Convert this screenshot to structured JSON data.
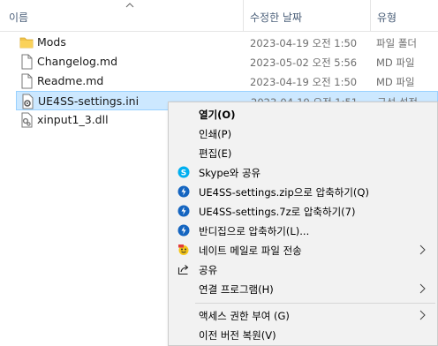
{
  "columns": {
    "name": "이름",
    "date": "수정한 날짜",
    "type": "유형"
  },
  "files": [
    {
      "name": "Mods",
      "date": "2023-04-19 오전 1:50",
      "type": "파일 폴더",
      "icon": "folder-icon"
    },
    {
      "name": "Changelog.md",
      "date": "2023-05-02 오전 5:56",
      "type": "MD 파일",
      "icon": "document-icon"
    },
    {
      "name": "Readme.md",
      "date": "2023-04-19 오전 1:50",
      "type": "MD 파일",
      "icon": "document-icon"
    },
    {
      "name": "UE4SS-settings.ini",
      "date": "2023-04-19 오전 1:51",
      "type": "구성 설정",
      "icon": "settings-file-icon"
    },
    {
      "name": "xinput1_3.dll",
      "date": "",
      "type": "",
      "icon": "dll-file-icon"
    }
  ],
  "menu": {
    "open": "열기(O)",
    "print": "인쇄(P)",
    "edit": "편집(E)",
    "skype_share": "Skype와 공유",
    "compress_zip": "UE4SS-settings.zip으로 압축하기(Q)",
    "compress_7z": "UE4SS-settings.7z로 압축하기(7)",
    "bandizip": "반디집으로 압축하기(L)...",
    "naver_mail": "네이트 메일로 파일 전송",
    "share": "공유",
    "open_with": "연결 프로그램(H)",
    "grant_access": "액세스 권한 부여 (G)",
    "restore_versions": "이전 버전 복원(V)"
  },
  "colors": {
    "selection_bg": "#cce8ff",
    "selection_border": "#99d1ff",
    "menu_bg": "#f2f2f2",
    "header_text": "#4c607a",
    "bandizip_blue": "#1565c0",
    "skype_blue": "#00aff0"
  }
}
